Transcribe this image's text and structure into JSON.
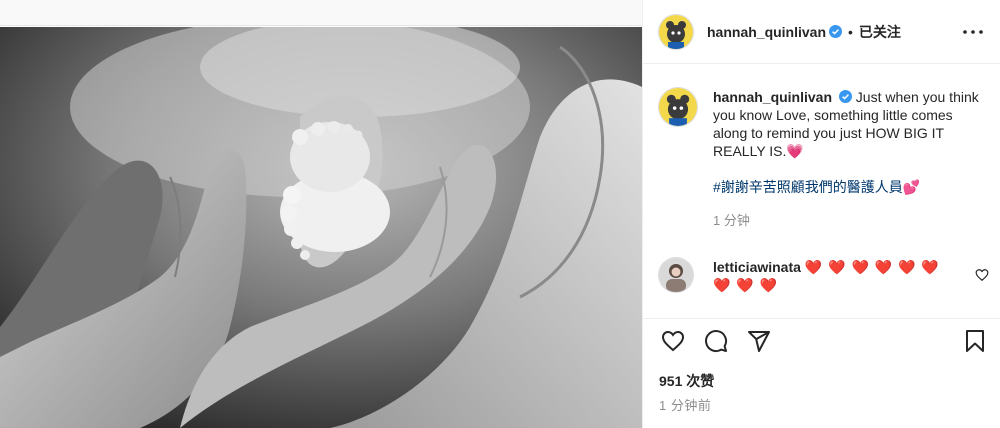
{
  "post": {
    "username": "hannah_quinlivan",
    "follow_separator": "•",
    "follow_status": "已关注",
    "caption_text": "Just when you think you know Love, something little comes along to remind you just HOW BIG IT REALLY IS.💗",
    "hashtag_text": "#謝謝辛苦照顧我們的醫護人員💕",
    "caption_time": "1 分钟",
    "likes": "951 次赞",
    "posted_time": "1 分钟前",
    "image_description": "black and white photo of parents' hands cradling baby feet"
  },
  "comments": [
    {
      "username": "letticiawinata",
      "text": "❤️ ❤️ ❤️ ❤️ ❤️ ❤️ ❤️ ❤️ ❤️"
    }
  ],
  "icons": {
    "verified": "verified-badge-icon",
    "more": "more-options-icon",
    "like": "heart-icon",
    "comment": "comment-icon",
    "share": "share-icon",
    "save": "bookmark-icon"
  },
  "colors": {
    "verified": "#3897f0",
    "hashtag": "#00376b",
    "secondary_text": "#8e8e8e",
    "border": "#efefef"
  }
}
